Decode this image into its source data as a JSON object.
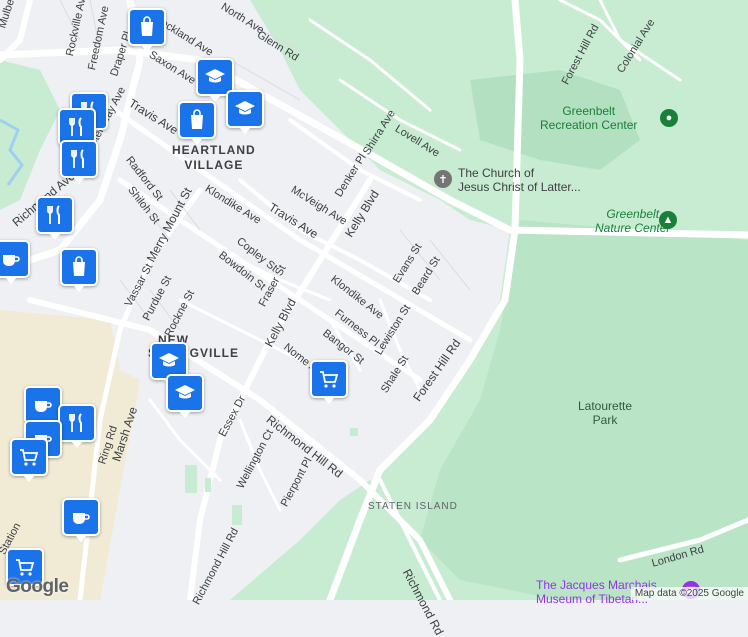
{
  "map": {
    "neighborhoods": {
      "heartland_line1": "HEARTLAND",
      "heartland_line2": "VILLAGE",
      "new": "NEW",
      "springville": "SPRINGVILLE",
      "staten_island": "STATEN ISLAND"
    },
    "places": {
      "greenbelt_rec_line1": "Greenbelt",
      "greenbelt_rec_line2": "Recreation Center",
      "greenbelt_nature_line1": "Greenbelt",
      "greenbelt_nature_line2": "Nature Center",
      "church_line1": "The Church of",
      "church_line2": "Jesus Christ of Latter...",
      "latourette_line1": "Latourette",
      "latourette_line2": "Park",
      "jacques_line1": "The Jacques Marchais",
      "jacques_line2": "Museum of Tibetan..."
    },
    "streets": {
      "mulberry": "Mulberry",
      "rockville": "Rockville Ave",
      "freedom": "Freedom Ave",
      "draper": "Draper Pl",
      "rockland": "Rockland Ave",
      "saxon": "Saxon Ave",
      "glenn": "Glenn Rd",
      "north": "North Ave",
      "forest_hill_top": "Forest Hill Rd",
      "colonial": "Colonial Ave",
      "travis_top": "Travis Ave",
      "steinway": "Steinway Ave",
      "shirra": "Shirra Ave",
      "lovell": "Lovell Ave",
      "radford": "Radford St",
      "shiloh": "Shiloh St",
      "merry_mount": "Merry Mount St",
      "klondike_left": "Klondike Ave",
      "mcveigh": "McVeigh Ave",
      "denker": "Denker Pl",
      "travis_mid": "Travis Ave",
      "kelly_top": "Kelly Blvd",
      "richmond_left": "Richmond Ave",
      "copley": "Copley St",
      "bowdoin": "Bowdoin St",
      "fraser": "Fraser St",
      "evans": "Evans St",
      "beard": "Beard St",
      "vassar": "Vassar St",
      "purdue": "Purdue St",
      "rockne": "Rockne St",
      "klondike_mid": "Klondike Ave",
      "furness": "Furness Pl",
      "lewiston": "Lewiston St",
      "kelly_mid": "Kelly Blvd",
      "nome": "Nome Ave",
      "bangor": "Bangor St",
      "forest_hill_mid": "Forest Hill Rd",
      "shale": "Shale St",
      "marsh": "Marsh Ave",
      "ring": "Ring Rd",
      "essex": "Essex Dr",
      "wellington": "Wellington Ct",
      "richmond_hill": "Richmond Hill Rd",
      "pierpont": "Pierpont Pl",
      "richmond_rd": "Richmond Rd",
      "london": "London Rd",
      "richmond_hill_bottom": "Richmond Hill Rd",
      "stations": "Station"
    },
    "pins": [
      {
        "type": "shopping",
        "icon": "shopping-bag-icon"
      },
      {
        "type": "school",
        "icon": "graduation-cap-icon"
      },
      {
        "type": "school",
        "icon": "graduation-cap-icon"
      },
      {
        "type": "shopping",
        "icon": "shopping-bag-icon"
      },
      {
        "type": "restaurant",
        "icon": "fork-knife-icon"
      },
      {
        "type": "restaurant",
        "icon": "fork-knife-icon"
      },
      {
        "type": "restaurant",
        "icon": "fork-knife-icon"
      },
      {
        "type": "cafe",
        "icon": "coffee-cup-icon"
      },
      {
        "type": "shopping",
        "icon": "shopping-bag-icon"
      },
      {
        "type": "school",
        "icon": "graduation-cap-icon"
      },
      {
        "type": "school",
        "icon": "graduation-cap-icon"
      },
      {
        "type": "grocery",
        "icon": "shopping-cart-icon"
      },
      {
        "type": "cafe",
        "icon": "coffee-cup-icon"
      },
      {
        "type": "restaurant",
        "icon": "fork-knife-icon"
      },
      {
        "type": "cafe",
        "icon": "coffee-cup-icon"
      },
      {
        "type": "grocery",
        "icon": "shopping-cart-icon"
      },
      {
        "type": "cafe",
        "icon": "coffee-cup-icon"
      },
      {
        "type": "grocery",
        "icon": "shopping-cart-icon"
      }
    ],
    "colors": {
      "park": "#c8ecd2",
      "park_dark": "#b3e0c1",
      "urban": "#eef0f3",
      "road": "#ffffff",
      "commercial": "#f1ebd6",
      "pin": "#1a73e8",
      "water": "#9fd0f0"
    },
    "logo": "Google",
    "attribution": "Map data ©2025 Google"
  }
}
